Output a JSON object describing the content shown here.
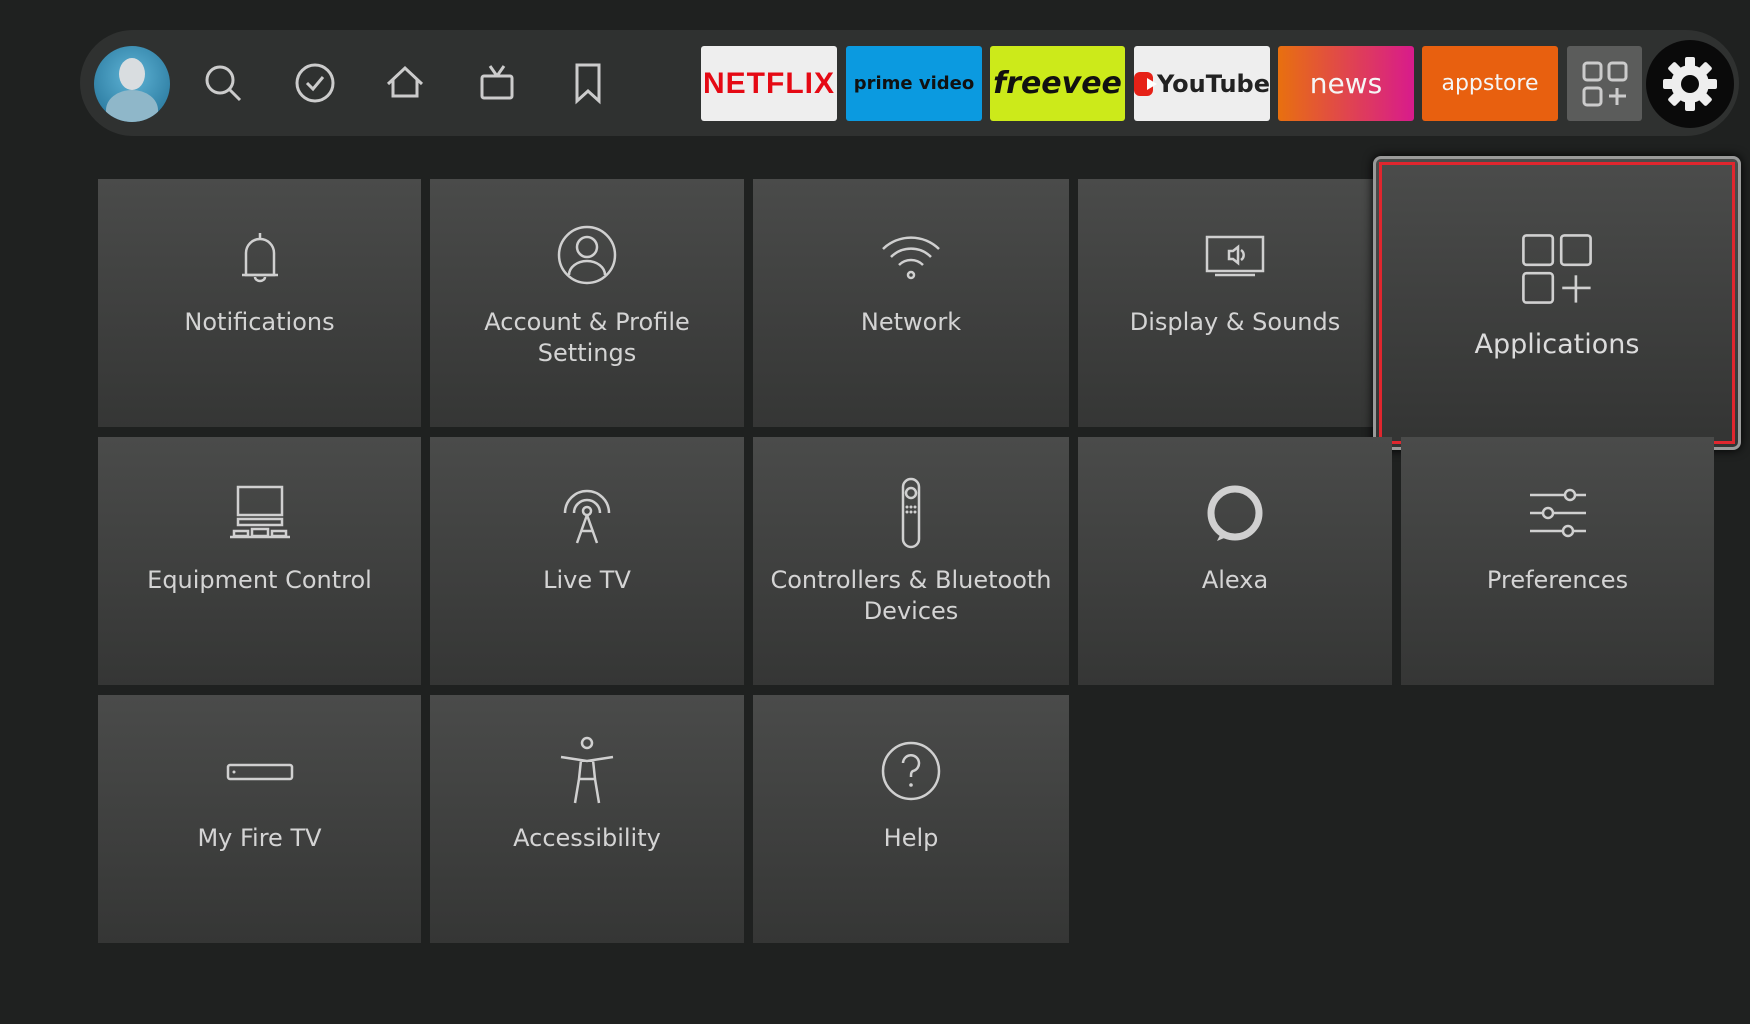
{
  "nav": {
    "icons": [
      "profile-avatar",
      "search-icon",
      "check-circle-icon",
      "home-icon",
      "live-tv-icon",
      "bookmark-icon"
    ],
    "apps": [
      {
        "label": "NETFLIX",
        "bg": "#eeeeee",
        "color": "#e50914"
      },
      {
        "label": "prime video",
        "bg": "#0b9ae0",
        "color": "#111111"
      },
      {
        "label": "freevee",
        "bg": "#ccea1a",
        "color": "#111111"
      },
      {
        "label": "YouTube",
        "bg": "#eeeeee",
        "color": "#222222"
      },
      {
        "label": "news",
        "bg": "#e8520f",
        "color": "#f5f5f5"
      },
      {
        "label": "appstore",
        "bg": "#e8600f",
        "color": "#f5f5f5"
      }
    ],
    "more_apps_icon": "apps-grid-icon",
    "settings_icon": "gear-icon"
  },
  "tiles": [
    {
      "label": "Notifications",
      "icon": "bell-icon"
    },
    {
      "label": "Account & Profile Settings",
      "icon": "user-circle-icon"
    },
    {
      "label": "Network",
      "icon": "wifi-icon"
    },
    {
      "label": "Display & Sounds",
      "icon": "display-icon"
    },
    {
      "label": "Applications",
      "icon": "apps-plus-icon",
      "focused": true
    },
    {
      "label": "Equipment Control",
      "icon": "equipment-icon"
    },
    {
      "label": "Live TV",
      "icon": "antenna-icon"
    },
    {
      "label": "Controllers & Bluetooth Devices",
      "icon": "remote-icon"
    },
    {
      "label": "Alexa",
      "icon": "alexa-icon"
    },
    {
      "label": "Preferences",
      "icon": "sliders-icon"
    },
    {
      "label": "My Fire TV",
      "icon": "fire-tv-stick-icon"
    },
    {
      "label": "Accessibility",
      "icon": "accessibility-icon"
    },
    {
      "label": "Help",
      "icon": "help-icon"
    }
  ],
  "focus_color": "#e0262e"
}
